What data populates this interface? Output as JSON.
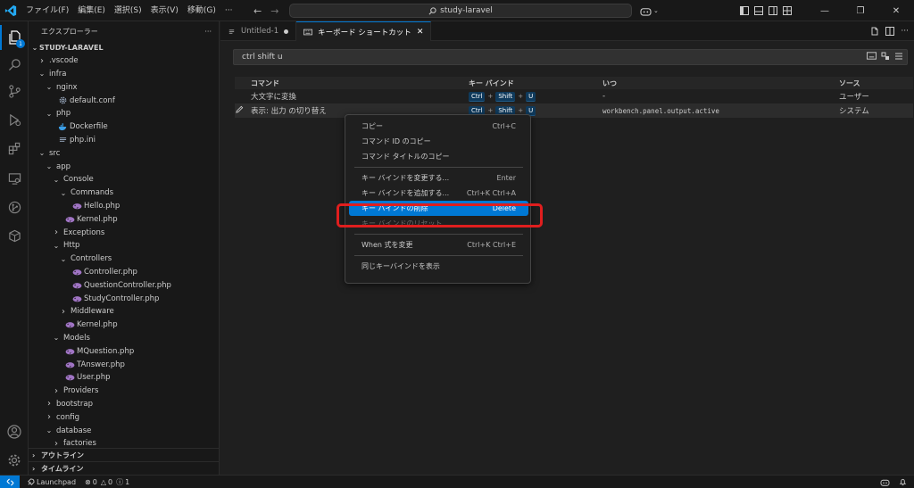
{
  "titlebar": {
    "menus": [
      "ファイル(F)",
      "編集(E)",
      "選択(S)",
      "表示(V)",
      "移動(G)",
      "···"
    ],
    "search_text": "study-laravel",
    "nav_back_icon": "arrow-left-icon",
    "nav_forward_icon": "arrow-right-icon",
    "window_controls": [
      "minimize",
      "restore",
      "close"
    ]
  },
  "activitybar": {
    "explorer_badge": "1",
    "icons": [
      "files-icon",
      "search-icon",
      "source-control-icon",
      "run-debug-icon",
      "extensions-icon",
      "remote-explorer-icon",
      "git-graph-icon",
      "containers-icon"
    ],
    "bottom_icons": [
      "account-icon",
      "settings-gear-icon"
    ]
  },
  "sidebar": {
    "title": "エクスプローラー",
    "more": "···",
    "root": "STUDY-LARAVEL",
    "tree": [
      {
        "label": ".vscode",
        "depth": 1,
        "type": "folder",
        "open": false
      },
      {
        "label": "infra",
        "depth": 1,
        "type": "folder",
        "open": true
      },
      {
        "label": "nginx",
        "depth": 2,
        "type": "folder",
        "open": true
      },
      {
        "label": "default.conf",
        "depth": 3,
        "type": "gear"
      },
      {
        "label": "php",
        "depth": 2,
        "type": "folder",
        "open": true
      },
      {
        "label": "Dockerfile",
        "depth": 3,
        "type": "docker"
      },
      {
        "label": "php.ini",
        "depth": 3,
        "type": "ini"
      },
      {
        "label": "src",
        "depth": 1,
        "type": "folder",
        "open": true
      },
      {
        "label": "app",
        "depth": 2,
        "type": "folder",
        "open": true
      },
      {
        "label": "Console",
        "depth": 3,
        "type": "folder",
        "open": true
      },
      {
        "label": "Commands",
        "depth": 4,
        "type": "folder",
        "open": true
      },
      {
        "label": "Hello.php",
        "depth": 5,
        "type": "php"
      },
      {
        "label": "Kernel.php",
        "depth": 4,
        "type": "php"
      },
      {
        "label": "Exceptions",
        "depth": 3,
        "type": "folder",
        "open": false
      },
      {
        "label": "Http",
        "depth": 3,
        "type": "folder",
        "open": true
      },
      {
        "label": "Controllers",
        "depth": 4,
        "type": "folder",
        "open": true
      },
      {
        "label": "Controller.php",
        "depth": 5,
        "type": "php"
      },
      {
        "label": "QuestionController.php",
        "depth": 5,
        "type": "php"
      },
      {
        "label": "StudyController.php",
        "depth": 5,
        "type": "php"
      },
      {
        "label": "Middleware",
        "depth": 4,
        "type": "folder",
        "open": false
      },
      {
        "label": "Kernel.php",
        "depth": 4,
        "type": "php"
      },
      {
        "label": "Models",
        "depth": 3,
        "type": "folder",
        "open": true
      },
      {
        "label": "MQuestion.php",
        "depth": 4,
        "type": "php"
      },
      {
        "label": "TAnswer.php",
        "depth": 4,
        "type": "php"
      },
      {
        "label": "User.php",
        "depth": 4,
        "type": "php"
      },
      {
        "label": "Providers",
        "depth": 3,
        "type": "folder",
        "open": false
      },
      {
        "label": "bootstrap",
        "depth": 2,
        "type": "folder",
        "open": false
      },
      {
        "label": "config",
        "depth": 2,
        "type": "folder",
        "open": false
      },
      {
        "label": "database",
        "depth": 2,
        "type": "folder",
        "open": true
      },
      {
        "label": "factories",
        "depth": 3,
        "type": "folder",
        "open": false
      }
    ],
    "outline_label": "アウトライン",
    "timeline_label": "タイムライン"
  },
  "tabs": [
    {
      "label": "Untitled-1",
      "dirty": true,
      "active": false
    },
    {
      "label": "キーボード ショートカット",
      "dirty": false,
      "active": true
    }
  ],
  "keybindings": {
    "search_value": "ctrl shift u",
    "columns": [
      "コマンド",
      "キー バインド",
      "いつ",
      "ソース"
    ],
    "rows": [
      {
        "command": "大文字に変換",
        "keys": [
          "Ctrl",
          "Shift",
          "U"
        ],
        "when": "-",
        "source": "ユーザー",
        "selected": false
      },
      {
        "command": "表示: 出力 の切り替え",
        "keys": [
          "Ctrl",
          "Shift",
          "U"
        ],
        "when": "workbench.panel.output.active",
        "source": "システム",
        "selected": true
      }
    ]
  },
  "context_menu": {
    "groups": [
      [
        {
          "label": "コピー",
          "shortcut": "Ctrl+C"
        },
        {
          "label": "コマンド ID のコピー",
          "shortcut": ""
        },
        {
          "label": "コマンド タイトルのコピー",
          "shortcut": ""
        }
      ],
      [
        {
          "label": "キー バインドを変更する...",
          "shortcut": "Enter"
        },
        {
          "label": "キー バインドを追加する...",
          "shortcut": "Ctrl+K Ctrl+A"
        },
        {
          "label": "キー バインドの削除",
          "shortcut": "Delete",
          "highlighted": true
        },
        {
          "label": "キー バインドのリセット",
          "shortcut": "",
          "disabled": true
        }
      ],
      [
        {
          "label": "When 式を変更",
          "shortcut": "Ctrl+K Ctrl+E"
        }
      ],
      [
        {
          "label": "同じキーバインドを表示",
          "shortcut": ""
        }
      ]
    ],
    "highlight_color": "#0078d4",
    "annotation_color": "#e01e1e"
  },
  "statusbar": {
    "launchpad": "Launchpad",
    "errors": "0",
    "warnings": "0",
    "info": "1"
  }
}
